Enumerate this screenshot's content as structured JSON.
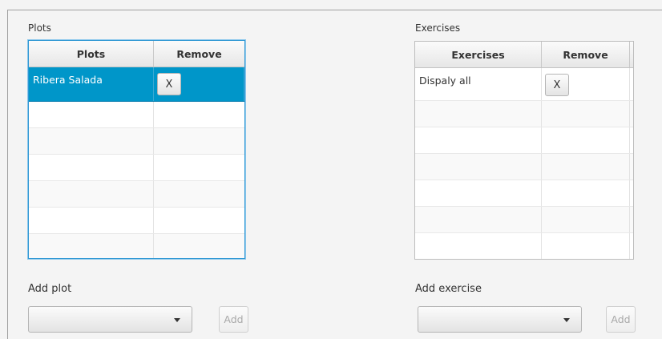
{
  "plots": {
    "label": "Plots",
    "table": {
      "columns": [
        "Plots",
        "Remove"
      ],
      "rows": [
        {
          "name": "Ribera Salada",
          "remove_label": "X",
          "selected": true
        }
      ],
      "empty_rows": 7
    },
    "add_label": "Add plot",
    "combo_value": "",
    "add_button": "Add"
  },
  "exercises": {
    "label": "Exercises",
    "table": {
      "columns": [
        "Exercises",
        "Remove"
      ],
      "rows": [
        {
          "name": "Dispaly all",
          "remove_label": "X",
          "selected": false
        }
      ],
      "empty_rows": 7
    },
    "add_label": "Add exercise",
    "combo_value": "",
    "add_button": "Add"
  },
  "colors": {
    "selection": "#0096c9",
    "focus_border": "#2f97d4",
    "disabled_text": "#a8a8a8"
  },
  "icons": {
    "combo_arrow": "chevron-down-icon"
  }
}
